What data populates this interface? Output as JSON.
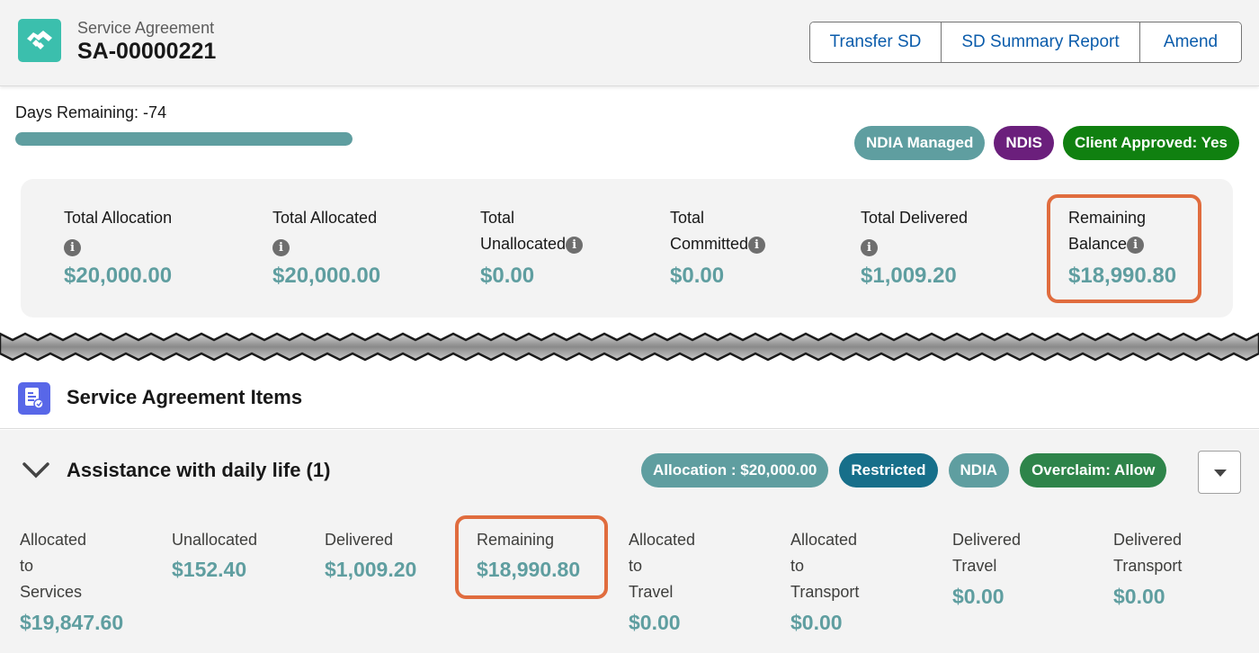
{
  "header": {
    "object_type": "Service Agreement",
    "record_name": "SA-00000221",
    "buttons": [
      "Transfer SD",
      "SD Summary Report",
      "Amend"
    ]
  },
  "days": {
    "label": "Days Remaining: -74",
    "progress_fraction": 1.0
  },
  "status_badges": [
    "NDIA Managed",
    "NDIS",
    "Client Approved: Yes"
  ],
  "summary": {
    "total_allocation_label": "Total Allocation",
    "total_allocation_value": "$20,000.00",
    "total_allocated_label": "Total Allocated",
    "total_allocated_value": "$20,000.00",
    "total_unallocated_label_1": "Total",
    "total_unallocated_label_2": "Unallocated",
    "total_unallocated_value": "$0.00",
    "total_committed_label_1": "Total",
    "total_committed_label_2": "Committed",
    "total_committed_value": "$0.00",
    "total_delivered_label": "Total Delivered",
    "total_delivered_value": "$1,009.20",
    "remaining_balance_label_1": "Remaining",
    "remaining_balance_label_2": "Balance",
    "remaining_balance_value": "$18,990.80"
  },
  "items_section": {
    "title": "Service Agreement Items"
  },
  "group": {
    "title": "Assistance with daily life (1)",
    "badges": [
      "Allocation : $20,000.00",
      "Restricted",
      "NDIA",
      "Overclaim: Allow"
    ],
    "stats": {
      "allocated_services_label_1": "Allocated",
      "allocated_services_label_2": "to",
      "allocated_services_label_3": "Services",
      "allocated_services_value": "$19,847.60",
      "unallocated_label": "Unallocated",
      "unallocated_value": "$152.40",
      "delivered_label": "Delivered",
      "delivered_value": "$1,009.20",
      "remaining_label": "Remaining",
      "remaining_value": "$18,990.80",
      "allocated_travel_label_1": "Allocated",
      "allocated_travel_label_2": "to",
      "allocated_travel_label_3": "Travel",
      "allocated_travel_value": "$0.00",
      "allocated_transport_label_1": "Allocated",
      "allocated_transport_label_2": "to",
      "allocated_transport_label_3": "Transport",
      "allocated_transport_value": "$0.00",
      "delivered_travel_label_1": "Delivered",
      "delivered_travel_label_2": "Travel",
      "delivered_travel_value": "$0.00",
      "delivered_transport_label_1": "Delivered",
      "delivered_transport_label_2": "Transport",
      "delivered_transport_value": "$0.00"
    }
  },
  "colors": {
    "accent_teal": "#5f9ea0",
    "link_blue": "#0b5cab",
    "highlight_orange": "#e06c3e",
    "badge_purple": "#6b1f7c",
    "badge_green": "#108010"
  }
}
